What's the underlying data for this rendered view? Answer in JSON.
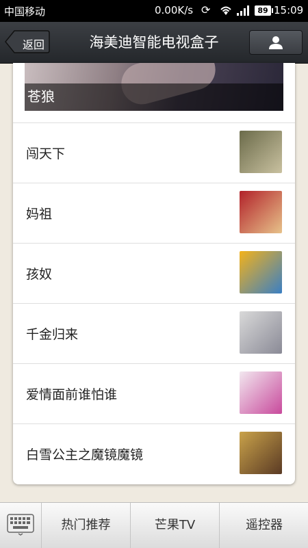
{
  "status": {
    "carrier": "中国移动",
    "speed": "0.00K/s",
    "battery": "89",
    "time": "15:09"
  },
  "header": {
    "back_label": "返回",
    "title": "海美迪智能电视盒子",
    "profile_icon": "user-icon"
  },
  "banner": {
    "label": "苍狼"
  },
  "items": [
    {
      "name": "闯天下",
      "colors": [
        "#6b6b4a",
        "#c9c1a0"
      ]
    },
    {
      "name": "妈祖",
      "colors": [
        "#b2222a",
        "#e7c28a"
      ]
    },
    {
      "name": "孩奴",
      "colors": [
        "#f3b21b",
        "#3a7fc4"
      ]
    },
    {
      "name": "千金归来",
      "colors": [
        "#d9d9d9",
        "#8a8a96"
      ]
    },
    {
      "name": "爱情面前谁怕谁",
      "colors": [
        "#f2e7ef",
        "#c84a9c"
      ]
    },
    {
      "name": "白雪公主之魔镜魔镜",
      "colors": [
        "#c9a24a",
        "#5a3a24"
      ]
    }
  ],
  "tabs": {
    "keyboard_icon": "keyboard-icon",
    "hot": "热门推荐",
    "mango": "芒果TV",
    "remote": "遥控器"
  }
}
